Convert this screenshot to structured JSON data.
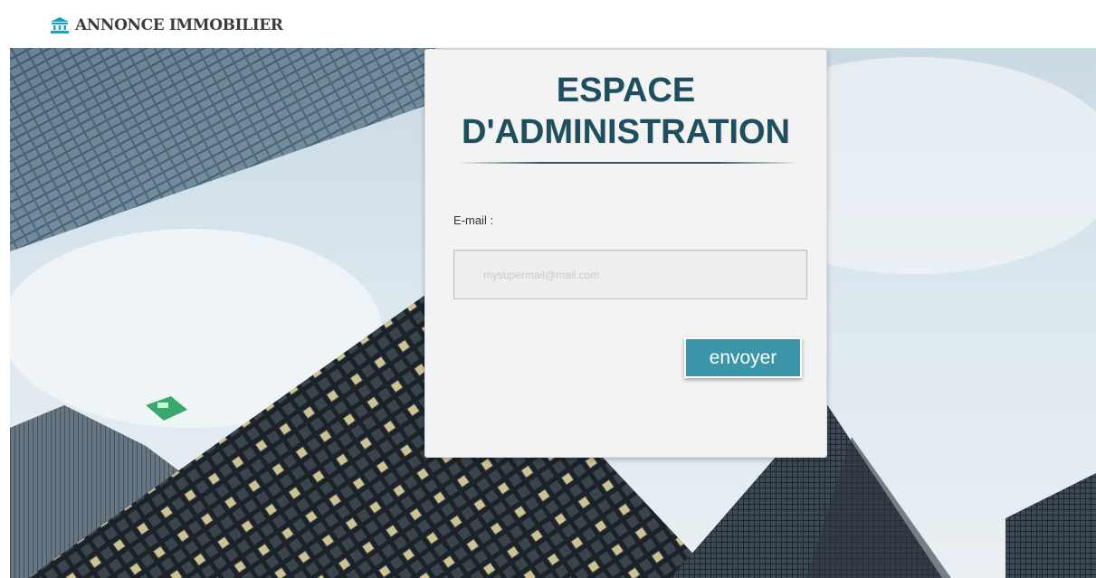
{
  "header": {
    "brand_text": "ANNONCE IMMOBILIER",
    "brand_icon": "bank-icon",
    "icon_color": "#1aa0c8"
  },
  "login": {
    "title": "ESPACE\nD'ADMINISTRATION",
    "email_label": "E-mail :",
    "email_placeholder": "mysupermail@mail.com",
    "email_value": "",
    "submit_label": "envoyer"
  },
  "colors": {
    "title": "#1f4e5e",
    "button": "#3a95a8",
    "card_background": "#f3f3f3"
  }
}
